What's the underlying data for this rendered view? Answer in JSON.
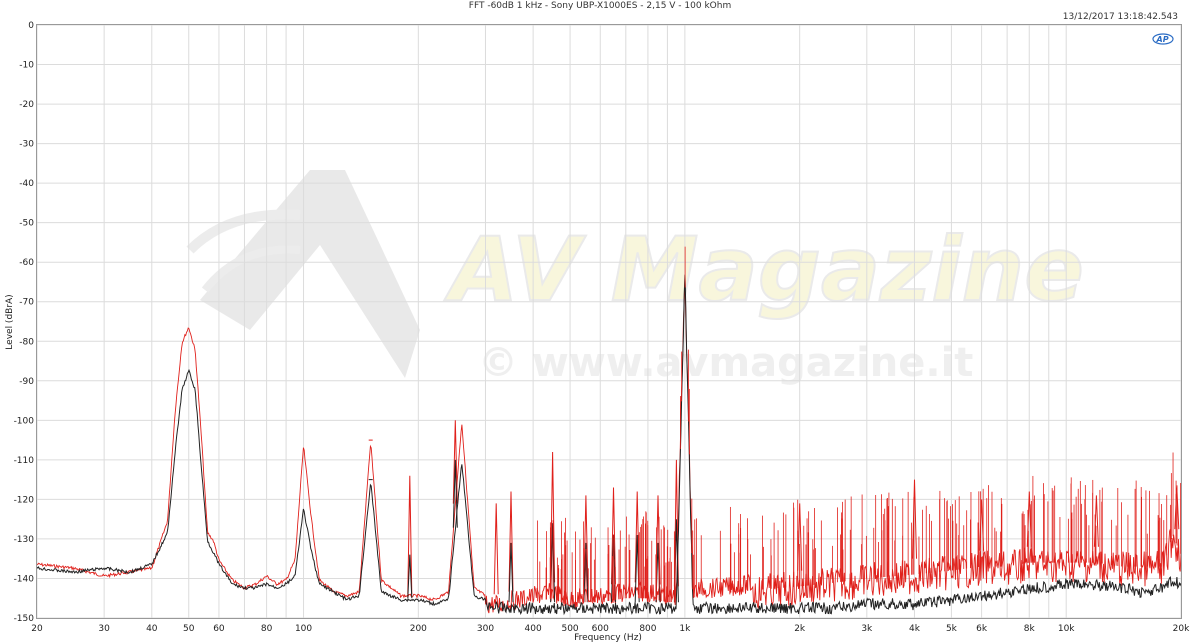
{
  "chart_data": {
    "type": "line",
    "title": "FFT -60dB 1 kHz - Sony UBP-X1000ES - 2,15 V - 100 kOhm",
    "timestamp": "13/12/2017 13:18:42.543",
    "xlabel": "Frequency (Hz)",
    "ylabel": "Level (dBrA)",
    "x_scale": "log",
    "xlim": [
      20,
      20000
    ],
    "ylim": [
      -150,
      0
    ],
    "x_ticks": [
      20,
      30,
      40,
      50,
      60,
      80,
      100,
      200,
      300,
      400,
      500,
      600,
      800,
      1000,
      2000,
      3000,
      4000,
      5000,
      6000,
      8000,
      10000,
      20000
    ],
    "x_tick_labels": [
      "20",
      "30",
      "40",
      "50",
      "60",
      "80",
      "100",
      "200",
      "300",
      "400",
      "500",
      "600",
      "800",
      "1k",
      "2k",
      "3k",
      "4k",
      "5k",
      "6k",
      "8k",
      "10k",
      "20k"
    ],
    "y_ticks": [
      0,
      -10,
      -20,
      -30,
      -40,
      -50,
      -60,
      -70,
      -80,
      -90,
      -100,
      -110,
      -120,
      -130,
      -140,
      -150
    ],
    "y_tick_labels": [
      "0",
      "-10",
      "-20",
      "-30",
      "-40",
      "-50",
      "-60",
      "-70",
      "-80",
      "-90",
      "-100",
      "-110",
      "-120",
      "-130",
      "-140",
      "-150"
    ],
    "grid": true,
    "watermark": {
      "logo": "AV Magazine",
      "url": "© www.avmagazine.it"
    },
    "series": [
      {
        "color": "#e0201b",
        "x": [
          20,
          25,
          30,
          35,
          40,
          44,
          46,
          48,
          50,
          52,
          54,
          56,
          58,
          60,
          65,
          70,
          75,
          80,
          85,
          90,
          95,
          100,
          105,
          110,
          120,
          130,
          140,
          150,
          160,
          180,
          200,
          220,
          240,
          260,
          280,
          300,
          330,
          360,
          400,
          450,
          500,
          550,
          600,
          700,
          800,
          900,
          950,
          1000,
          1050,
          1100,
          1200,
          1500,
          2000,
          2500,
          3000,
          4000,
          5000,
          6000,
          7000,
          8000,
          10000,
          12000,
          14000,
          16000,
          18000,
          19000,
          20000
        ],
        "values": [
          -136,
          -137,
          -139,
          -138,
          -137,
          -125,
          -98,
          -80,
          -76,
          -82,
          -104,
          -128,
          -130,
          -135,
          -140,
          -142,
          -141,
          -139,
          -141,
          -140,
          -135,
          -106,
          -125,
          -140,
          -143,
          -144,
          -143,
          -105,
          -140,
          -144,
          -144,
          -145,
          -143,
          -100,
          -142,
          -144,
          -144,
          -143,
          -142,
          -141,
          -143,
          -142,
          -142,
          -141,
          -141,
          -142,
          -142,
          -60,
          -141,
          -140,
          -140,
          -139,
          -138,
          -137,
          -136,
          -135,
          -134,
          -133,
          -133,
          -132,
          -132,
          -132,
          -133,
          -133,
          -133,
          -125,
          -130
        ]
      },
      {
        "color": "#222222",
        "x": [
          20,
          25,
          30,
          35,
          40,
          44,
          46,
          48,
          50,
          52,
          54,
          56,
          58,
          60,
          65,
          70,
          75,
          80,
          85,
          90,
          95,
          100,
          105,
          110,
          120,
          130,
          140,
          150,
          160,
          180,
          200,
          220,
          240,
          260,
          280,
          300,
          330,
          360,
          400,
          450,
          500,
          550,
          600,
          700,
          800,
          900,
          950,
          1000,
          1050,
          1100,
          1200,
          1500,
          2000,
          2500,
          3000,
          4000,
          5000,
          6000,
          7000,
          8000,
          10000,
          12000,
          14000,
          16000,
          18000,
          19000,
          20000
        ],
        "values": [
          -137,
          -138,
          -137,
          -138,
          -136,
          -128,
          -108,
          -92,
          -87,
          -92,
          -112,
          -130,
          -133,
          -136,
          -141,
          -142,
          -142,
          -141,
          -142,
          -141,
          -139,
          -122,
          -133,
          -141,
          -143,
          -145,
          -144,
          -115,
          -143,
          -145,
          -145,
          -146,
          -145,
          -110,
          -144,
          -145,
          -146,
          -146,
          -146,
          -146,
          -146,
          -146,
          -146,
          -146,
          -146,
          -146,
          -146,
          -61,
          -146,
          -146,
          -146,
          -146,
          -146,
          -146,
          -145,
          -145,
          -144,
          -143,
          -142,
          -141,
          -140,
          -140,
          -141,
          -142,
          -141,
          -139,
          -140
        ]
      }
    ],
    "harmonic_peaks": {
      "red": [
        [
          150,
          -105
        ],
        [
          250,
          -100
        ],
        [
          350,
          -118
        ],
        [
          450,
          -108
        ],
        [
          550,
          -119
        ],
        [
          650,
          -117
        ],
        [
          750,
          -118
        ],
        [
          850,
          -119
        ],
        [
          950,
          -110
        ],
        [
          190,
          -114
        ],
        [
          320,
          -121
        ],
        [
          2000,
          -121
        ],
        [
          4000,
          -115
        ],
        [
          6000,
          -120
        ],
        [
          8000,
          -118
        ],
        [
          12000,
          -119
        ],
        [
          19500,
          -117
        ]
      ],
      "black": [
        [
          150,
          -115
        ],
        [
          250,
          -110
        ],
        [
          190,
          -134
        ],
        [
          350,
          -131
        ],
        [
          450,
          -126
        ],
        [
          550,
          -131
        ],
        [
          650,
          -129
        ],
        [
          750,
          -129
        ],
        [
          850,
          -131
        ],
        [
          950,
          -125
        ]
      ]
    }
  }
}
